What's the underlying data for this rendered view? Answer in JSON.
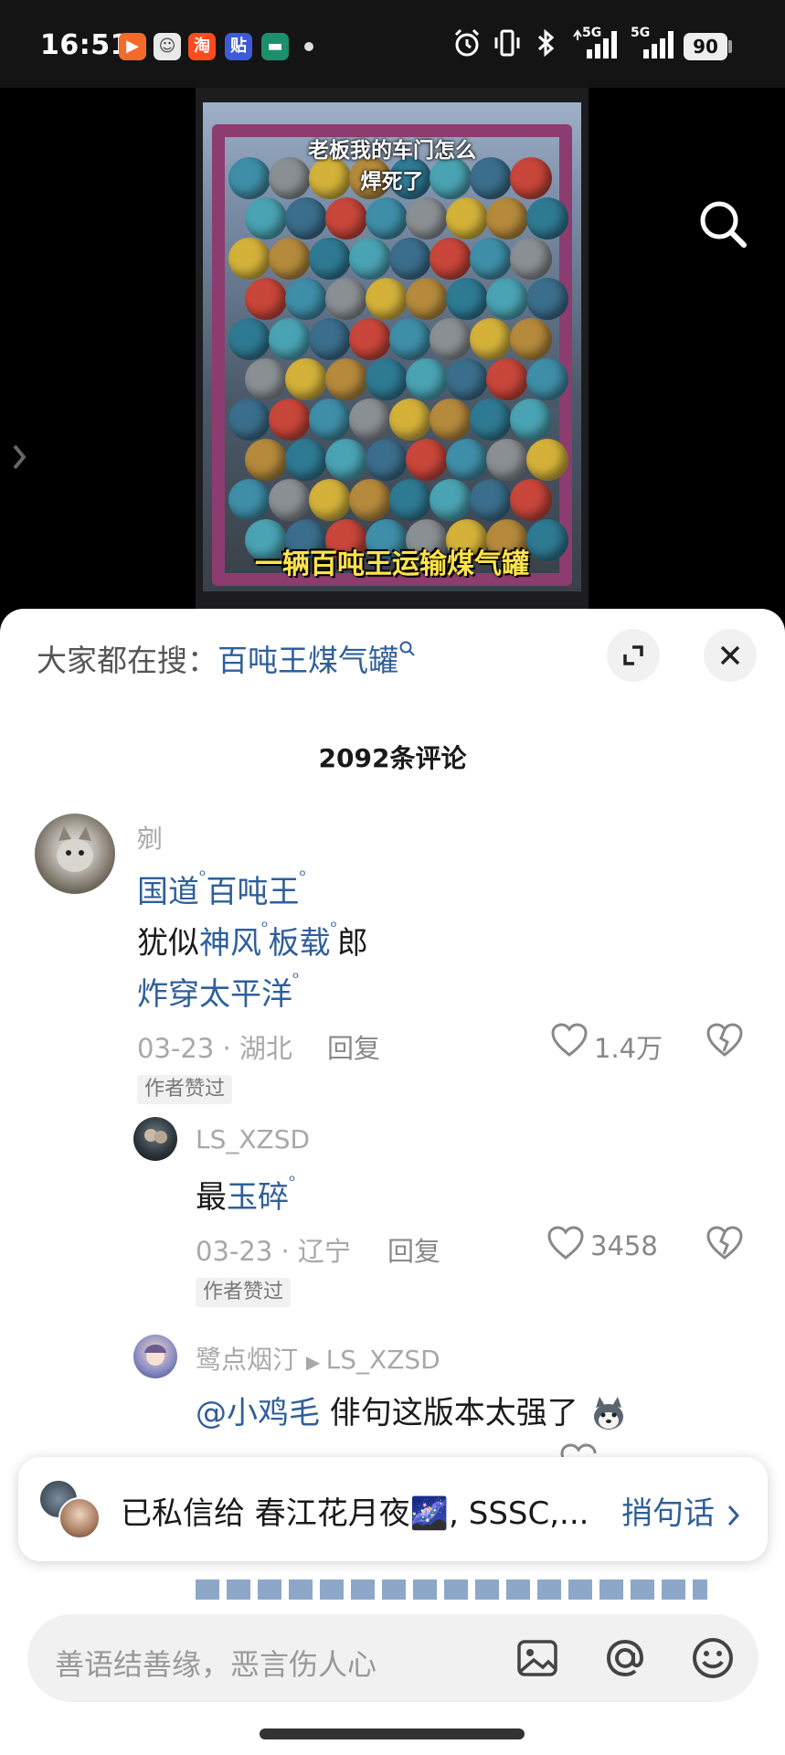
{
  "status_bar": {
    "time": "16:51",
    "apps": [
      {
        "icon": "video-app-icon",
        "label": "▶",
        "color": "#f36b2a"
      },
      {
        "icon": "avatar-app-icon",
        "label": "☺",
        "color": "#e9e9e9"
      },
      {
        "icon": "taobao-icon",
        "label": "淘",
        "color": "#ff4b1f"
      },
      {
        "icon": "tieba-icon",
        "label": "贴",
        "color": "#3d5bd8"
      },
      {
        "icon": "card-app-icon",
        "label": "▬",
        "color": "#1d8f6b"
      }
    ],
    "signal_label_1": "5G",
    "signal_label_2": "5G",
    "battery": "90"
  },
  "video": {
    "top_caption_line1": "老板我的车门怎么",
    "top_caption_line2": "焊死了",
    "bottom_caption": "一辆百吨王运输煤气罐"
  },
  "sheet": {
    "hot_search_label": "大家都在搜：",
    "hot_search_keyword": "百吨王煤气罐",
    "comment_count": "2092条评论"
  },
  "comments": [
    {
      "user": "剜",
      "line1": {
        "kw1": "国道",
        "kw2": "百吨王"
      },
      "line2": {
        "pre": "犹似",
        "kw1": "神风",
        "kw2": "板载",
        "post": "郎"
      },
      "line3": {
        "kw1": "炸穿太平洋"
      },
      "meta": "03-23 · 湖北",
      "reply": "回复",
      "likes": "1.4万",
      "badge": "作者赞过"
    },
    {
      "user": "LS_XZSD",
      "pre": "最",
      "kw": "玉碎",
      "meta": "03-23 · 辽宁",
      "reply": "回复",
      "likes": "3458",
      "badge": "作者赞过"
    },
    {
      "user": "鹭点烟汀",
      "reply_to": "LS_XZSD",
      "mention": "@小鸡毛",
      "text": " 俳句这版本太强了"
    }
  ],
  "toast": {
    "text": "已私信给 春江花月夜🌌, SSSC,...",
    "action": "捎句话"
  },
  "input": {
    "placeholder": "善语结善缘，恶言伤人心"
  }
}
